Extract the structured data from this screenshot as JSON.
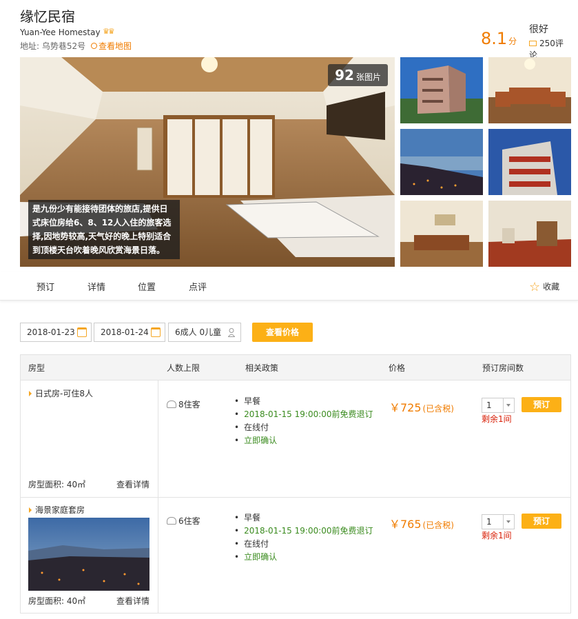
{
  "hotel": {
    "name": "缘忆民宿",
    "english_name": "Yuan-Yee Homestay",
    "address_label": "地址:",
    "address": "乌势巷52号",
    "map_link": "查看地图",
    "score": "8.1",
    "score_unit": "分",
    "rating_text": "很好",
    "review_count": "250评论",
    "crown_count": 2
  },
  "gallery": {
    "photo_count": "92",
    "photo_count_label": "张图片",
    "description": "是九份少有能接待团体的旅店,提供日式床位房给6、8、12人入住的旅客选择,因地势较高,天气好的晚上特别适合到顶楼天台吹着晚风欣赏海景日落。"
  },
  "tabs": [
    {
      "label": "预订"
    },
    {
      "label": "详情"
    },
    {
      "label": "位置"
    },
    {
      "label": "点评"
    }
  ],
  "favorite_label": "收藏",
  "search": {
    "checkin": "2018-01-23",
    "checkout": "2018-01-24",
    "guests": "6成人 0儿童",
    "button": "查看价格"
  },
  "table": {
    "headers": [
      "房型",
      "人数上限",
      "相关政策",
      "价格",
      "预订房间数"
    ],
    "rooms": [
      {
        "name": "日式房-可住8人",
        "area": "房型面积:  40㎡",
        "detail": "查看详情",
        "capacity": "8住客",
        "policies": [
          "早餐",
          "2018-01-15 19:00:00前免费退订",
          "在线付",
          "立即确认"
        ],
        "price": "￥725",
        "price_note": "(已含税)",
        "qty": "1",
        "book": "预订",
        "remaining": "剩余1间"
      },
      {
        "name": "海景家庭套房",
        "area": "房型面积:  40㎡",
        "detail": "查看详情",
        "capacity": "6住客",
        "policies": [
          "早餐",
          "2018-01-15 19:00:00前免费退订",
          "在线付",
          "立即确认"
        ],
        "price": "￥765",
        "price_note": "(已含税)",
        "qty": "1",
        "book": "预订",
        "remaining": "剩余1间"
      }
    ]
  },
  "colors": {
    "accent": "#f07c00",
    "button": "#fcb016",
    "green": "#3a8b1e",
    "red": "#d81e06"
  }
}
